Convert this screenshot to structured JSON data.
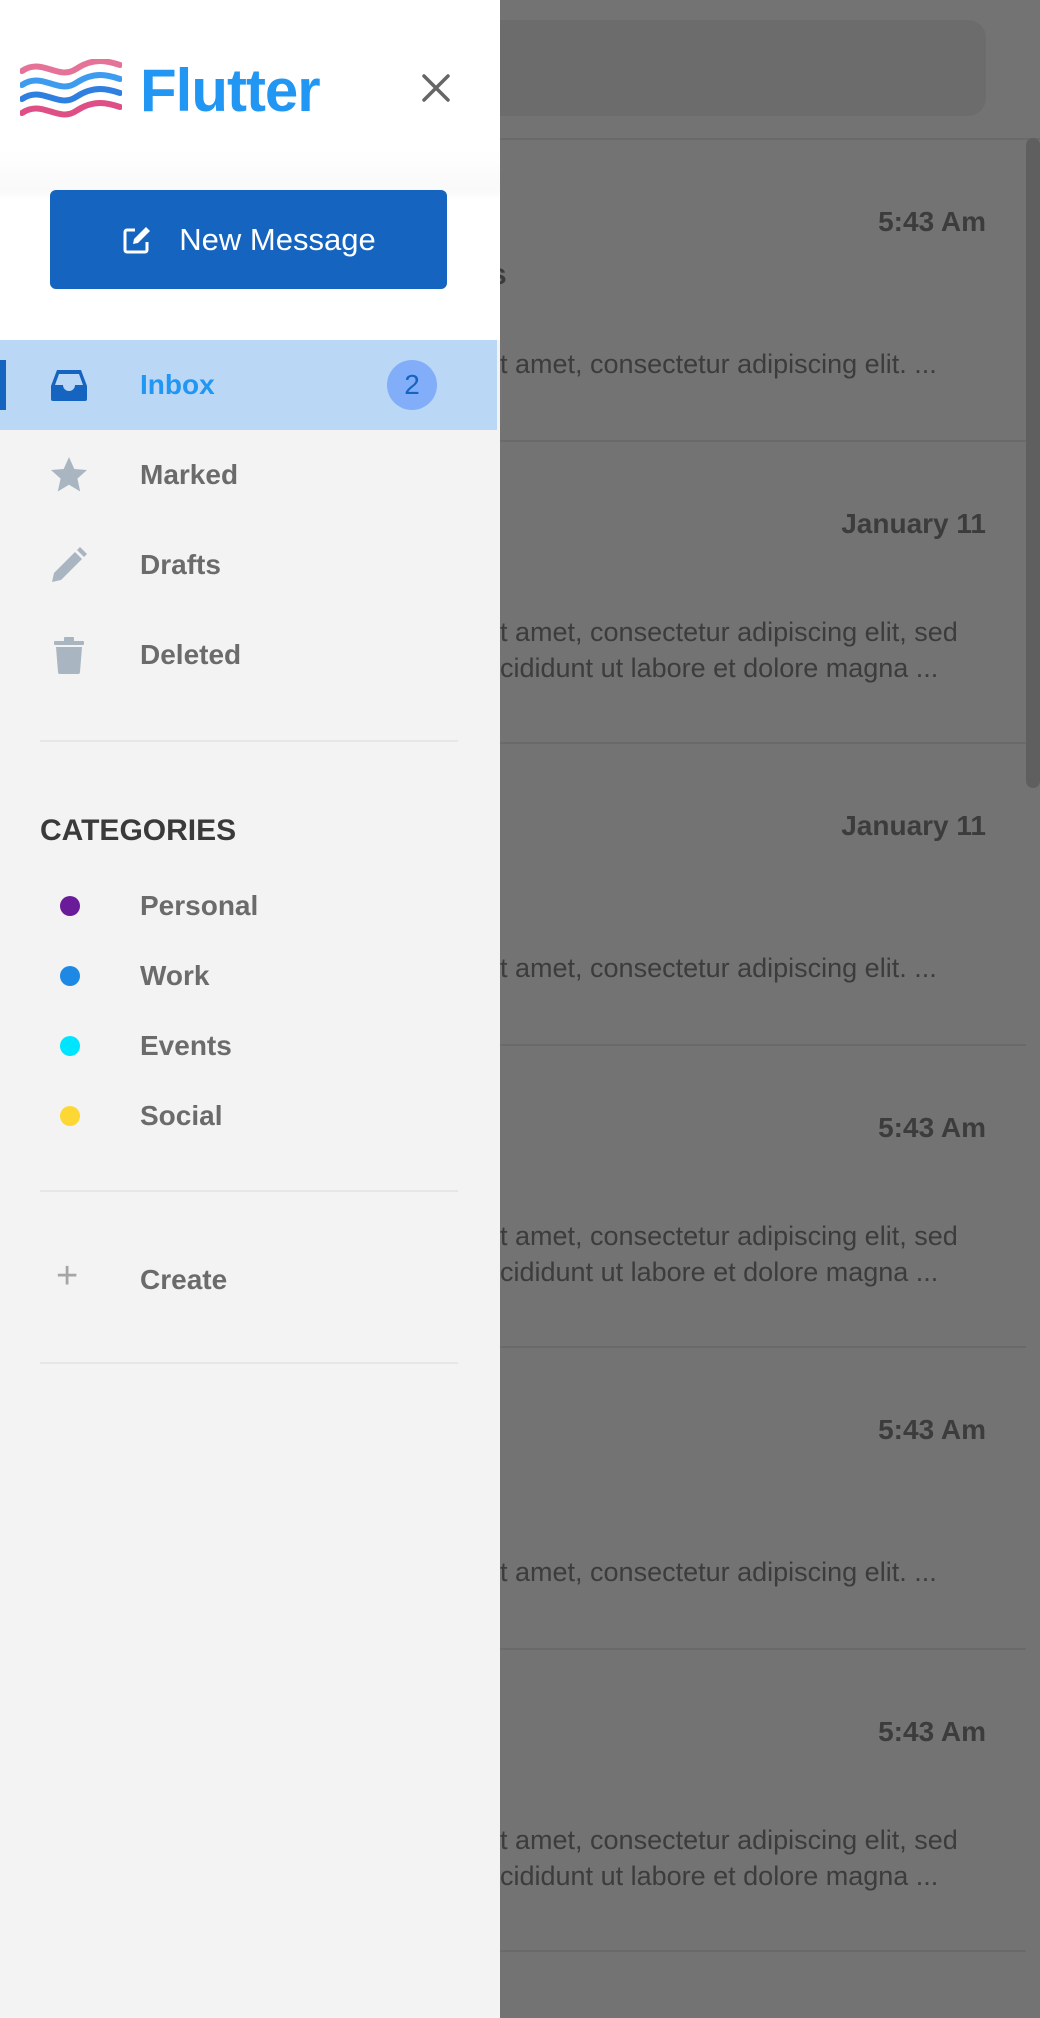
{
  "app": {
    "brand_name": "Flutter",
    "accent_color": "#2196f3",
    "primary_button_color": "#1565c0"
  },
  "drawer": {
    "close_icon": "close-icon",
    "new_message_label": "New Message",
    "new_message_icon": "edit-icon",
    "nav": [
      {
        "id": "inbox",
        "label": "Inbox",
        "icon": "inbox-icon",
        "badge": "2",
        "active": true
      },
      {
        "id": "marked",
        "label": "Marked",
        "icon": "star-icon"
      },
      {
        "id": "drafts",
        "label": "Drafts",
        "icon": "pencil-icon"
      },
      {
        "id": "deleted",
        "label": "Deleted",
        "icon": "trash-icon"
      }
    ],
    "categories_title": "CATEGORIES",
    "categories": [
      {
        "label": "Personal",
        "color": "#6a1b9a"
      },
      {
        "label": "Work",
        "color": "#1e88e5"
      },
      {
        "label": "Events",
        "color": "#00e5ff"
      },
      {
        "label": "Social",
        "color": "#fdd835"
      }
    ],
    "create_label": "Create",
    "create_icon": "plus-icon"
  },
  "background_list": {
    "items": [
      {
        "time": "5:43 Am",
        "subject_fragment": "s",
        "preview": "t amet, consectetur adipiscing elit. ..."
      },
      {
        "time": "January 11",
        "preview": "t amet, consectetur adipiscing elit, sed\ncididunt ut labore et dolore magna ..."
      },
      {
        "time": "January 11",
        "preview": "t amet, consectetur adipiscing elit. ..."
      },
      {
        "time": "5:43 Am",
        "preview": "t amet, consectetur adipiscing elit, sed\ncididunt ut labore et dolore magna ..."
      },
      {
        "time": "5:43 Am",
        "preview": "t amet, consectetur adipiscing elit. ..."
      },
      {
        "time": "5:43 Am",
        "preview": "t amet, consectetur adipiscing elit, sed\ncididunt ut labore et dolore magna ..."
      }
    ]
  }
}
